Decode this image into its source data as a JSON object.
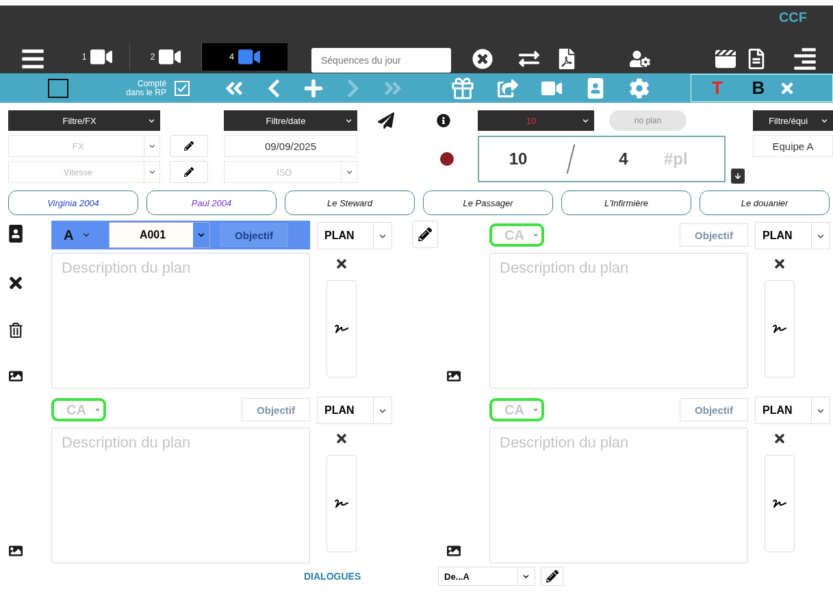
{
  "header": {
    "brand": "CCF",
    "camera_tabs": [
      {
        "label": "1",
        "selected": false
      },
      {
        "label": "2",
        "selected": false
      },
      {
        "label": "4",
        "selected": true
      }
    ],
    "search": {
      "placeholder": "Séquences du jour"
    }
  },
  "toolbar": {
    "select_all": {
      "checked": false
    },
    "counted": {
      "label": "Compté dans le RP",
      "checked": true
    },
    "nav": [
      {
        "kind": "first",
        "disabled": false
      },
      {
        "kind": "prev",
        "disabled": false
      },
      {
        "kind": "add",
        "disabled": false
      },
      {
        "kind": "next",
        "disabled": true
      },
      {
        "kind": "last",
        "disabled": true
      }
    ],
    "format": [
      {
        "kind": "text",
        "label": "T"
      },
      {
        "kind": "bold",
        "label": "B"
      }
    ]
  },
  "filters": {
    "fx": "Filtre/FX",
    "date": "Filtre/date",
    "number": "10",
    "no_plan": {
      "label": "no plan",
      "disabled": true
    },
    "team": "Filtre/équi"
  },
  "fields": {
    "fx_placeholder": "FX",
    "speed_placeholder": "Vitesse",
    "date": "09/09/2025",
    "iso_placeholder": "ISO",
    "counter_a": "10",
    "counter_b": "4",
    "counter_placeholder": "#pl",
    "team": "Equipe A"
  },
  "characters": [
    {
      "name": "Virginia 2004",
      "color": "#1f3fd0"
    },
    {
      "name": "Paul 2004",
      "color": "#7a2ed8"
    },
    {
      "name": "Le Steward",
      "color": "#111111"
    },
    {
      "name": "Le Passager",
      "color": "#111111"
    },
    {
      "name": "L'Infirmière",
      "color": "#111111"
    },
    {
      "name": "Le douanier",
      "color": "#111111"
    }
  ],
  "plans": [
    {
      "selected": true,
      "camera": "A",
      "code": "A001",
      "highlighted": false,
      "objective": "Objectif",
      "plan": "PLAN",
      "placeholder": "Description du plan"
    },
    {
      "selected": false,
      "camera": "CA",
      "highlighted": true,
      "objective": "Objectif",
      "plan": "PLAN",
      "placeholder": "Description du plan"
    },
    {
      "selected": false,
      "camera": "CA",
      "highlighted": true,
      "objective": "Objectif",
      "plan": "PLAN",
      "placeholder": "Description du plan"
    },
    {
      "selected": false,
      "camera": "CA",
      "highlighted": true,
      "objective": "Objectif",
      "plan": "PLAN",
      "placeholder": "Description du plan"
    }
  ],
  "footer": {
    "section": "DIALOGUES",
    "select": "De...A"
  }
}
